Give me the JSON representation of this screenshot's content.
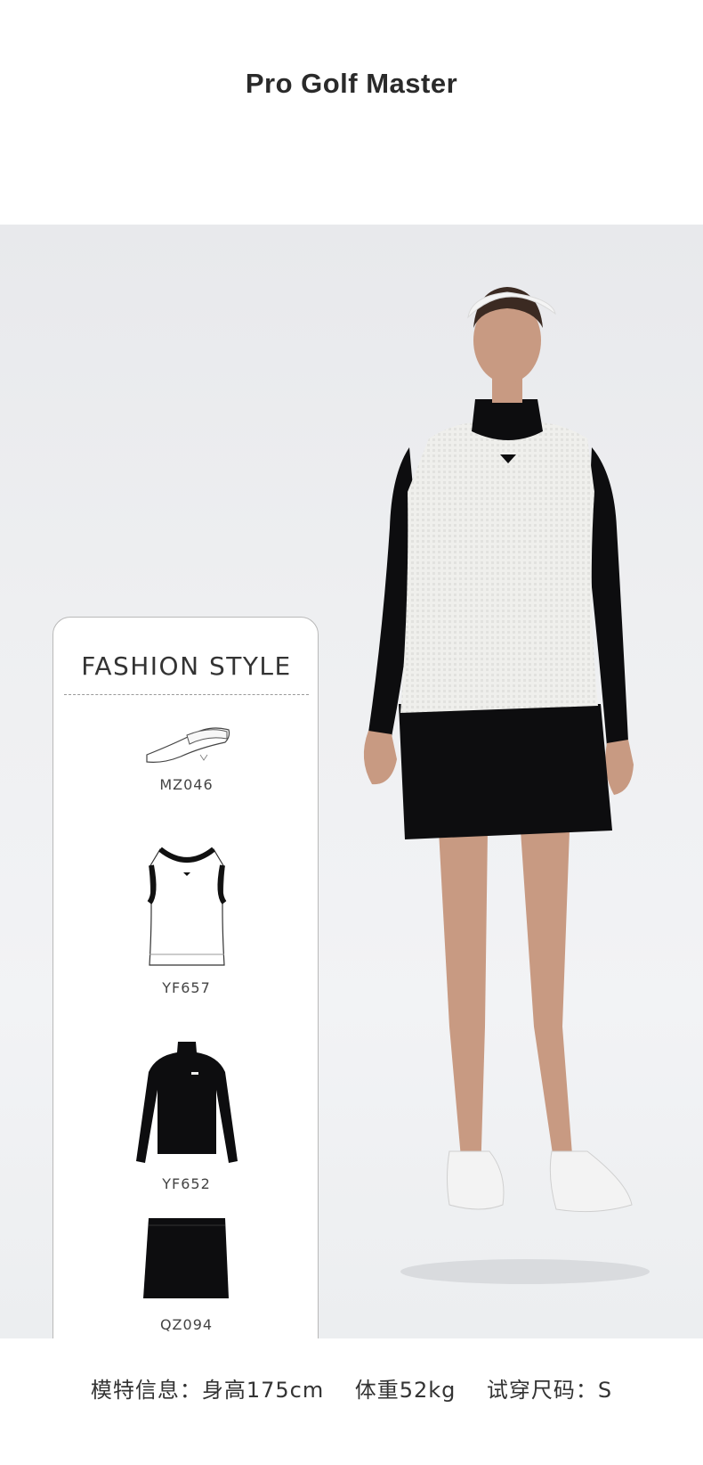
{
  "header": {
    "title": "Pro Golf Master"
  },
  "card": {
    "title": "FASHION STYLE",
    "items": [
      {
        "icon": "visor-icon",
        "code": "MZ046"
      },
      {
        "icon": "vest-icon",
        "code": "YF657"
      },
      {
        "icon": "turtleneck-icon",
        "code": "YF652"
      },
      {
        "icon": "skirt-icon",
        "code": "QZ094"
      }
    ]
  },
  "footer": {
    "info": "模特信息：身高175cm    体重52kg    试穿尺码：S"
  },
  "colors": {
    "background": "#ffffff",
    "photo_backdrop": "#eceef0",
    "card_border": "#b9b9b9",
    "garment_black": "#0d0d0f",
    "vest_white": "#ededeb"
  }
}
